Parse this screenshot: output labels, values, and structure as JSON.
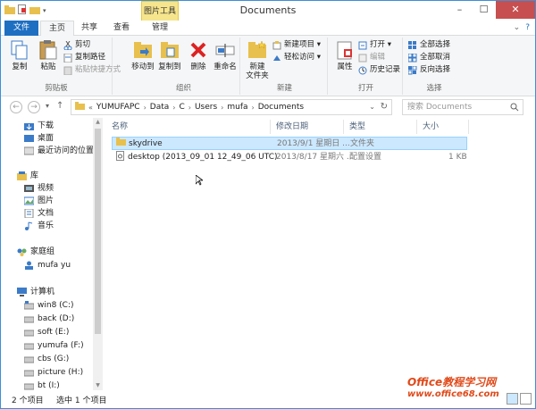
{
  "window": {
    "title": "Documents",
    "context_tab": "图片工具"
  },
  "tabs": {
    "file": "文件",
    "home": "主页",
    "share": "共享",
    "view": "查看",
    "manage": "管理"
  },
  "ribbon": {
    "clipboard": {
      "copy": "复制",
      "paste": "粘贴",
      "cut": "剪切",
      "copy_path": "复制路径",
      "paste_shortcut": "粘贴快捷方式",
      "label": "剪贴板"
    },
    "organize": {
      "move_to": "移动到",
      "copy_to": "复制到",
      "delete": "删除",
      "rename": "重命名",
      "label": "组织"
    },
    "new": {
      "new_folder_line1": "新建",
      "new_folder_line2": "文件夹",
      "new_item": "新建项目 ▾",
      "easy_access": "轻松访问 ▾",
      "label": "新建"
    },
    "open": {
      "properties": "属性",
      "open": "打开 ▾",
      "edit": "编辑",
      "history": "历史记录",
      "label": "打开"
    },
    "select": {
      "select_all": "全部选择",
      "select_none": "全部取消",
      "invert": "反向选择",
      "label": "选择"
    }
  },
  "address": {
    "crumbs": [
      "YUMUFAPC",
      "Data",
      "C",
      "Users",
      "mufa",
      "Documents"
    ],
    "search_placeholder": "搜索 Documents"
  },
  "nav": {
    "downloads": "下载",
    "desktop": "桌面",
    "recent": "最近访问的位置",
    "libraries": "库",
    "videos": "视频",
    "pictures": "图片",
    "documents": "文档",
    "music": "音乐",
    "homegroup": "家庭组",
    "user": "mufa yu",
    "computer": "计算机",
    "drives": [
      "win8 (C:)",
      "back (D:)",
      "soft (E:)",
      "yumufa (F:)",
      "cbs (G:)",
      "picture (H:)",
      "bt (I:)"
    ]
  },
  "columns": {
    "name": "名称",
    "date": "修改日期",
    "type": "类型",
    "size": "大小"
  },
  "files": [
    {
      "name": "skydrive",
      "date": "2013/9/1 星期日 ...",
      "type": "文件夹",
      "size": ""
    },
    {
      "name": "desktop (2013_09_01 12_49_06 UTC)",
      "date": "2013/8/17 星期六 ...",
      "type": "配置设置",
      "size": "1 KB"
    }
  ],
  "status": {
    "count": "2 个项目",
    "selected": "选中 1 个项目"
  },
  "watermark": {
    "text": "Office教程学习网",
    "url": "www.office68.com"
  }
}
